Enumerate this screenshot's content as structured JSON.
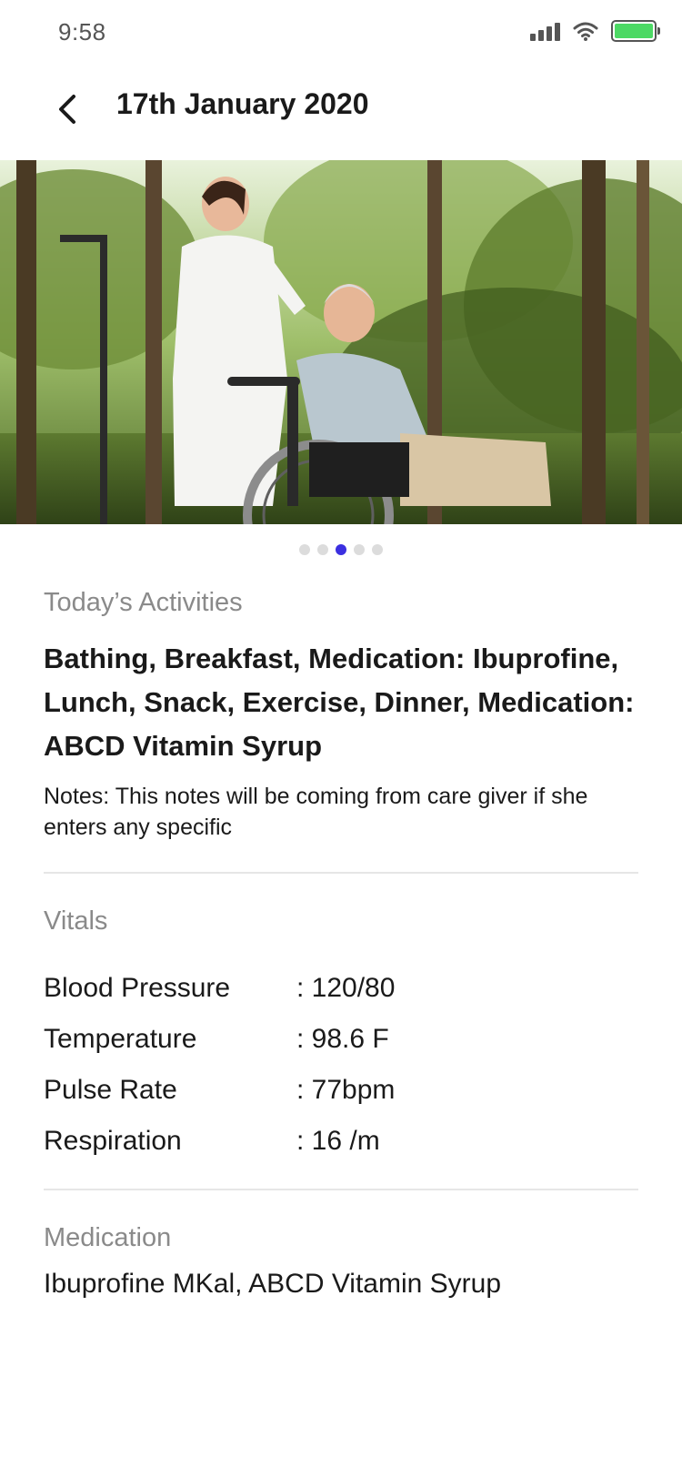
{
  "status_bar": {
    "time": "9:58",
    "battery_level": 1.0,
    "battery_color": "#4cd964"
  },
  "header": {
    "title": "17th January 2020",
    "back_icon": "chevron-left-icon"
  },
  "carousel": {
    "total": 5,
    "active_index": 2,
    "active_color": "#3b2fe0"
  },
  "activities": {
    "label": "Today’s Activities",
    "summary": "Bathing, Breakfast, Medication: Ibuprofine, Lunch, Snack, Exercise, Dinner, Medication: ABCD Vitamin Syrup",
    "notes": "Notes: This notes will be coming from care giver if she enters any specific"
  },
  "vitals": {
    "label": "Vitals",
    "rows": [
      {
        "label": "Blood Pressure",
        "value": ": 120/80"
      },
      {
        "label": "Temperature",
        "value": ": 98.6 F"
      },
      {
        "label": "Pulse Rate",
        "value": ": 77bpm"
      },
      {
        "label": "Respiration",
        "value": ": 16 /m"
      }
    ]
  },
  "medication": {
    "label": "Medication",
    "value": "Ibuprofine MKal, ABCD Vitamin Syrup"
  }
}
